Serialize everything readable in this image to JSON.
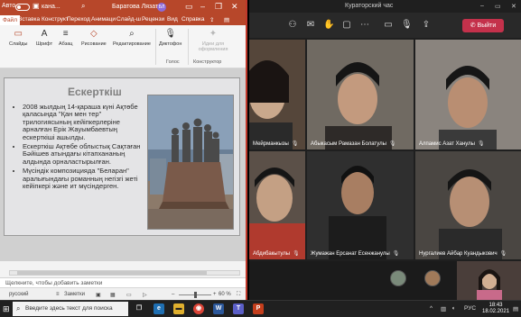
{
  "powerpoint": {
    "autosave_label": "Авто",
    "file_name": "кана...",
    "user_name": "Баратова Лязат",
    "user_initials": "БЛ",
    "tabs": [
      "Файл",
      "Вставка",
      "Конструкт",
      "Переход",
      "Анимаци",
      "Слайд-ш",
      "Рецензи",
      "Вид",
      "Справка"
    ],
    "ribbon": {
      "slides": "Слайды",
      "font": "Шрифт",
      "paragraph": "Абзац",
      "drawing": "Рисование",
      "editing": "Редактирование",
      "dictate": "Диктофон",
      "design_ideas": "Идеи для оформления",
      "group_voice": "Голос",
      "group_designer": "Конструктор"
    },
    "slide": {
      "title": "Ескерткіш",
      "bullets": [
        "2008 жылдың 14-қараша күні Ақтөбе қаласында \"Қан мен тер\" трилогиясының кейіпкерлеріне арналған Ерік Жауымбаевтың ескерткіші ашылды.",
        "Ескерткіш Ақтөбе облыстық Сақтаған Бәйішев атындағы кітапхананың алдында орналастырылған.",
        "Мүсіндік композицияда \"Беларан\" аралығындағы романның негізгі жеті кейіпкері және ит мүсіндерген."
      ]
    },
    "notes_placeholder": "Щелкните, чтобы добавить заметки",
    "status": {
      "language": "русский",
      "notes_button": "Заметки",
      "zoom": "60 %"
    }
  },
  "teams": {
    "window_title": "Кураторский час",
    "timer": "",
    "leave_label": "Выйти",
    "participants": [
      {
        "name": "Мейрманкызы"
      },
      {
        "name": "Абыкасым Рамазан Болатулы"
      },
      {
        "name": "Алпамис Азат Ханулы"
      },
      {
        "name": "Абдибакытулы"
      },
      {
        "name": "Жумажан Ерсанат Есенжанулы"
      },
      {
        "name": "Нургалиев Айбар Куандыкович"
      }
    ]
  },
  "taskbar": {
    "search_placeholder": "Введите здесь текст для поиска",
    "language": "РУС",
    "time": "18:43",
    "date": "18.02.2021"
  }
}
